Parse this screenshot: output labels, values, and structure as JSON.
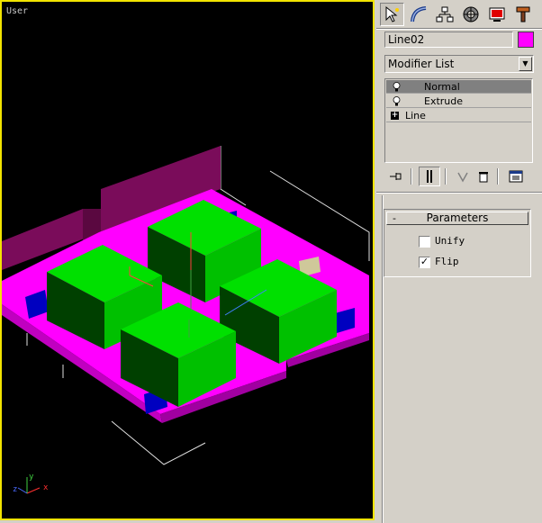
{
  "viewport": {
    "label": "User",
    "border_color": "#f2e400",
    "axis": {
      "x": "x",
      "y": "y",
      "z": "z"
    }
  },
  "panel": {
    "tabs": [
      {
        "name": "create-tab",
        "icon": "cursor-star-icon"
      },
      {
        "name": "modify-tab",
        "icon": "bend-arc-icon"
      },
      {
        "name": "hierarchy-tab",
        "icon": "hierarchy-icon"
      },
      {
        "name": "motion-tab",
        "icon": "motion-wheel-icon"
      },
      {
        "name": "display-tab",
        "icon": "monitor-icon"
      },
      {
        "name": "utilities-tab",
        "icon": "hammer-icon"
      }
    ],
    "object_name": "Line02",
    "object_color": "#ff00ff",
    "modifier_list": "Modifier List",
    "stack": [
      {
        "label": "Normal",
        "selected": true,
        "icon": "lightbulb-icon"
      },
      {
        "label": "Extrude",
        "selected": false,
        "icon": "lightbulb-icon"
      },
      {
        "label": "Line",
        "selected": false,
        "icon": "expand-plus-icon"
      }
    ],
    "parameters": {
      "toggle": "-",
      "title": "Parameters",
      "options": [
        {
          "label": "Unify",
          "checked": false
        },
        {
          "label": "Flip",
          "checked": true
        }
      ]
    }
  }
}
